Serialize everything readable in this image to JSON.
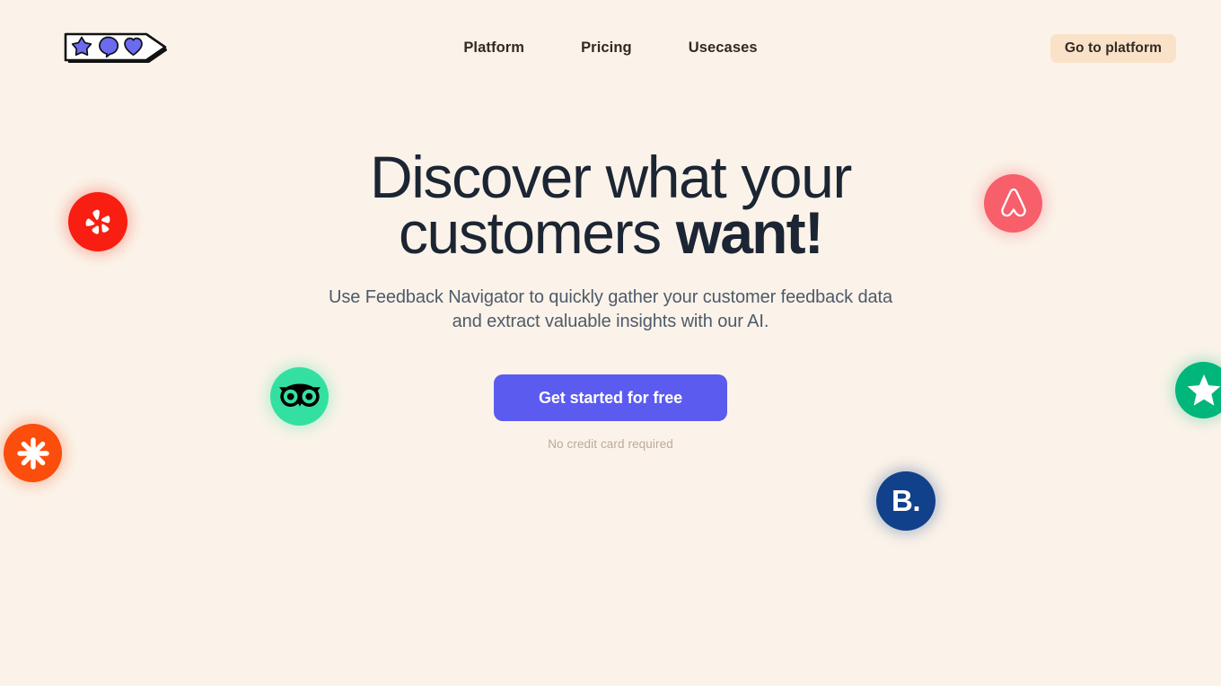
{
  "page": {
    "background_color": "#fbf3e9"
  },
  "header": {
    "logo": {
      "name": "feedback-navigator-logo",
      "icons": [
        "star-icon",
        "speech-bubble-icon",
        "heart-icon"
      ],
      "shape_color": "#ffffff",
      "icon_color": "#6b6bf0",
      "outline_color": "#1a1a1a"
    },
    "nav": [
      {
        "label": "Platform",
        "name": "nav-item-platform"
      },
      {
        "label": "Pricing",
        "name": "nav-item-pricing"
      },
      {
        "label": "Usecases",
        "name": "nav-item-usecases"
      }
    ],
    "cta": {
      "label": "Go to platform",
      "background_color": "#fae2c8",
      "text_color": "#312a24"
    }
  },
  "hero": {
    "title_regular": "Discover what your customers ",
    "title_emphasis": "want!",
    "title_color": "#1c2533",
    "subtitle": "Use Feedback Navigator to quickly gather your customer feedback data and extract valuable insights with our AI.",
    "subtitle_color": "#4e5a6b",
    "cta": {
      "label": "Get started for free",
      "background_color": "#5b5bf0",
      "text_color": "#ffffff"
    },
    "cta_note": "No credit card required",
    "cta_note_color": "#b9ab99"
  },
  "floating_badges": [
    {
      "name": "yelp-logo-badge",
      "brand": "Yelp",
      "color": "#f81e11",
      "icon": "yelp-burst-icon"
    },
    {
      "name": "airbnb-logo-badge",
      "brand": "Airbnb",
      "color": "#f75f6a",
      "icon": "airbnb-belo-icon"
    },
    {
      "name": "tripadvisor-logo-badge",
      "brand": "Tripadvisor",
      "color": "#34e0a1",
      "icon": "tripadvisor-owl-icon"
    },
    {
      "name": "asterisk-logo-badge",
      "brand": "Asterisk",
      "color": "#fb4d0b",
      "icon": "asterisk-icon"
    },
    {
      "name": "trustpilot-logo-badge",
      "brand": "Trustpilot",
      "color": "#00b67a",
      "icon": "star-icon"
    },
    {
      "name": "booking-logo-badge",
      "brand": "Booking.com",
      "color": "#11418b",
      "icon": "booking-b-icon",
      "text": "B."
    }
  ]
}
